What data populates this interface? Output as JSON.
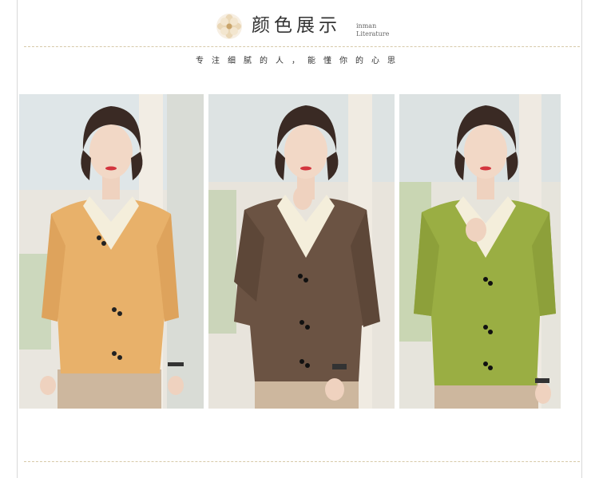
{
  "header": {
    "title": "颜色展示",
    "subtitle_line1": "inman",
    "subtitle_line2": "Literature",
    "logo_icon": "flower-icon"
  },
  "tagline": "专注细腻的人，能懂你的心思",
  "colors": {
    "text": "#333333",
    "accent_dots": "#d7c9a8",
    "cardigan_yellow": "#e8b16a",
    "cardigan_brown": "#6b5343",
    "cardigan_green": "#9aae43",
    "blouse_cream": "#f4eedb",
    "pants_beige": "#cdb79e"
  },
  "photos": [
    {
      "cardigan_color": "yellow"
    },
    {
      "cardigan_color": "brown"
    },
    {
      "cardigan_color": "green"
    }
  ]
}
